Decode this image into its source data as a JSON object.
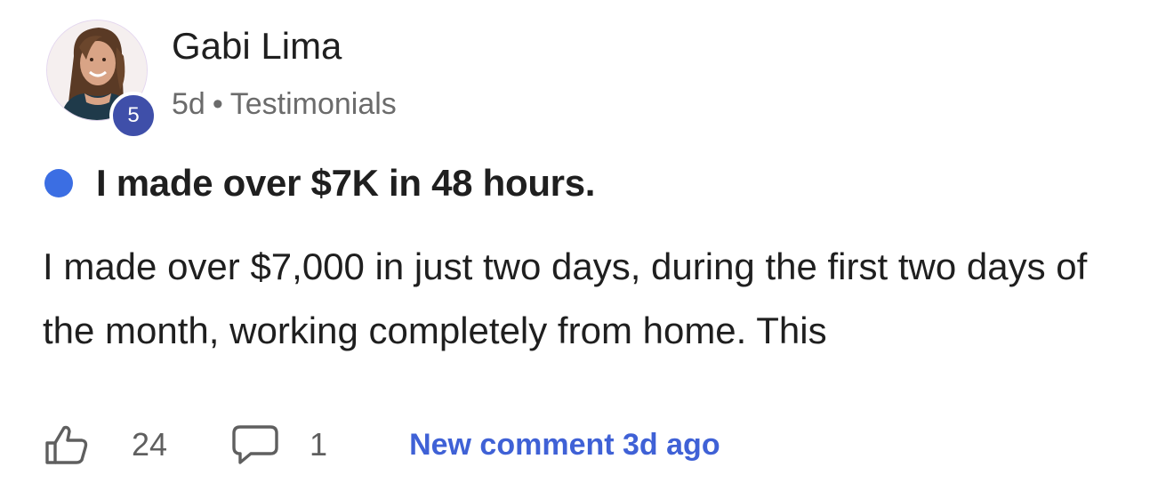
{
  "author": {
    "name": "Gabi Lima",
    "level": "5",
    "avatar_icon": "profile-photo"
  },
  "meta": {
    "age": "5d",
    "separator": "•",
    "category": "Testimonials"
  },
  "post": {
    "unread_color": "#3b6ee3",
    "title": "I made over $7K in 48 hours.",
    "body": "I made over $7,000 in just two days, during the first two days of the month, working completely from home. This"
  },
  "actions": {
    "like_icon": "thumbs-up-icon",
    "like_count": "24",
    "comment_icon": "comment-bubble-icon",
    "comment_count": "1",
    "new_comment_label": "New comment 3d ago",
    "link_color": "#3f61d6"
  },
  "colors": {
    "badge": "#3f4fa9",
    "text": "#1f1f1f",
    "muted": "#6b6b6b"
  }
}
